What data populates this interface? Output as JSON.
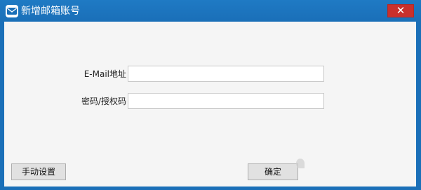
{
  "window": {
    "title": "新增邮箱账号",
    "close_glyph": "✕",
    "app_icon": "mail-app-icon"
  },
  "form": {
    "email_label": "E-Mail地址",
    "email_value": "",
    "email_placeholder": "",
    "password_label": "密码/授权码",
    "password_value": "",
    "password_placeholder": ""
  },
  "footer": {
    "manual_setup_label": "手动设置",
    "confirm_label": "确定"
  },
  "colors": {
    "titlebar": "#1a6fb8",
    "close_button": "#c9302c",
    "client_background": "#f5f5f5"
  }
}
